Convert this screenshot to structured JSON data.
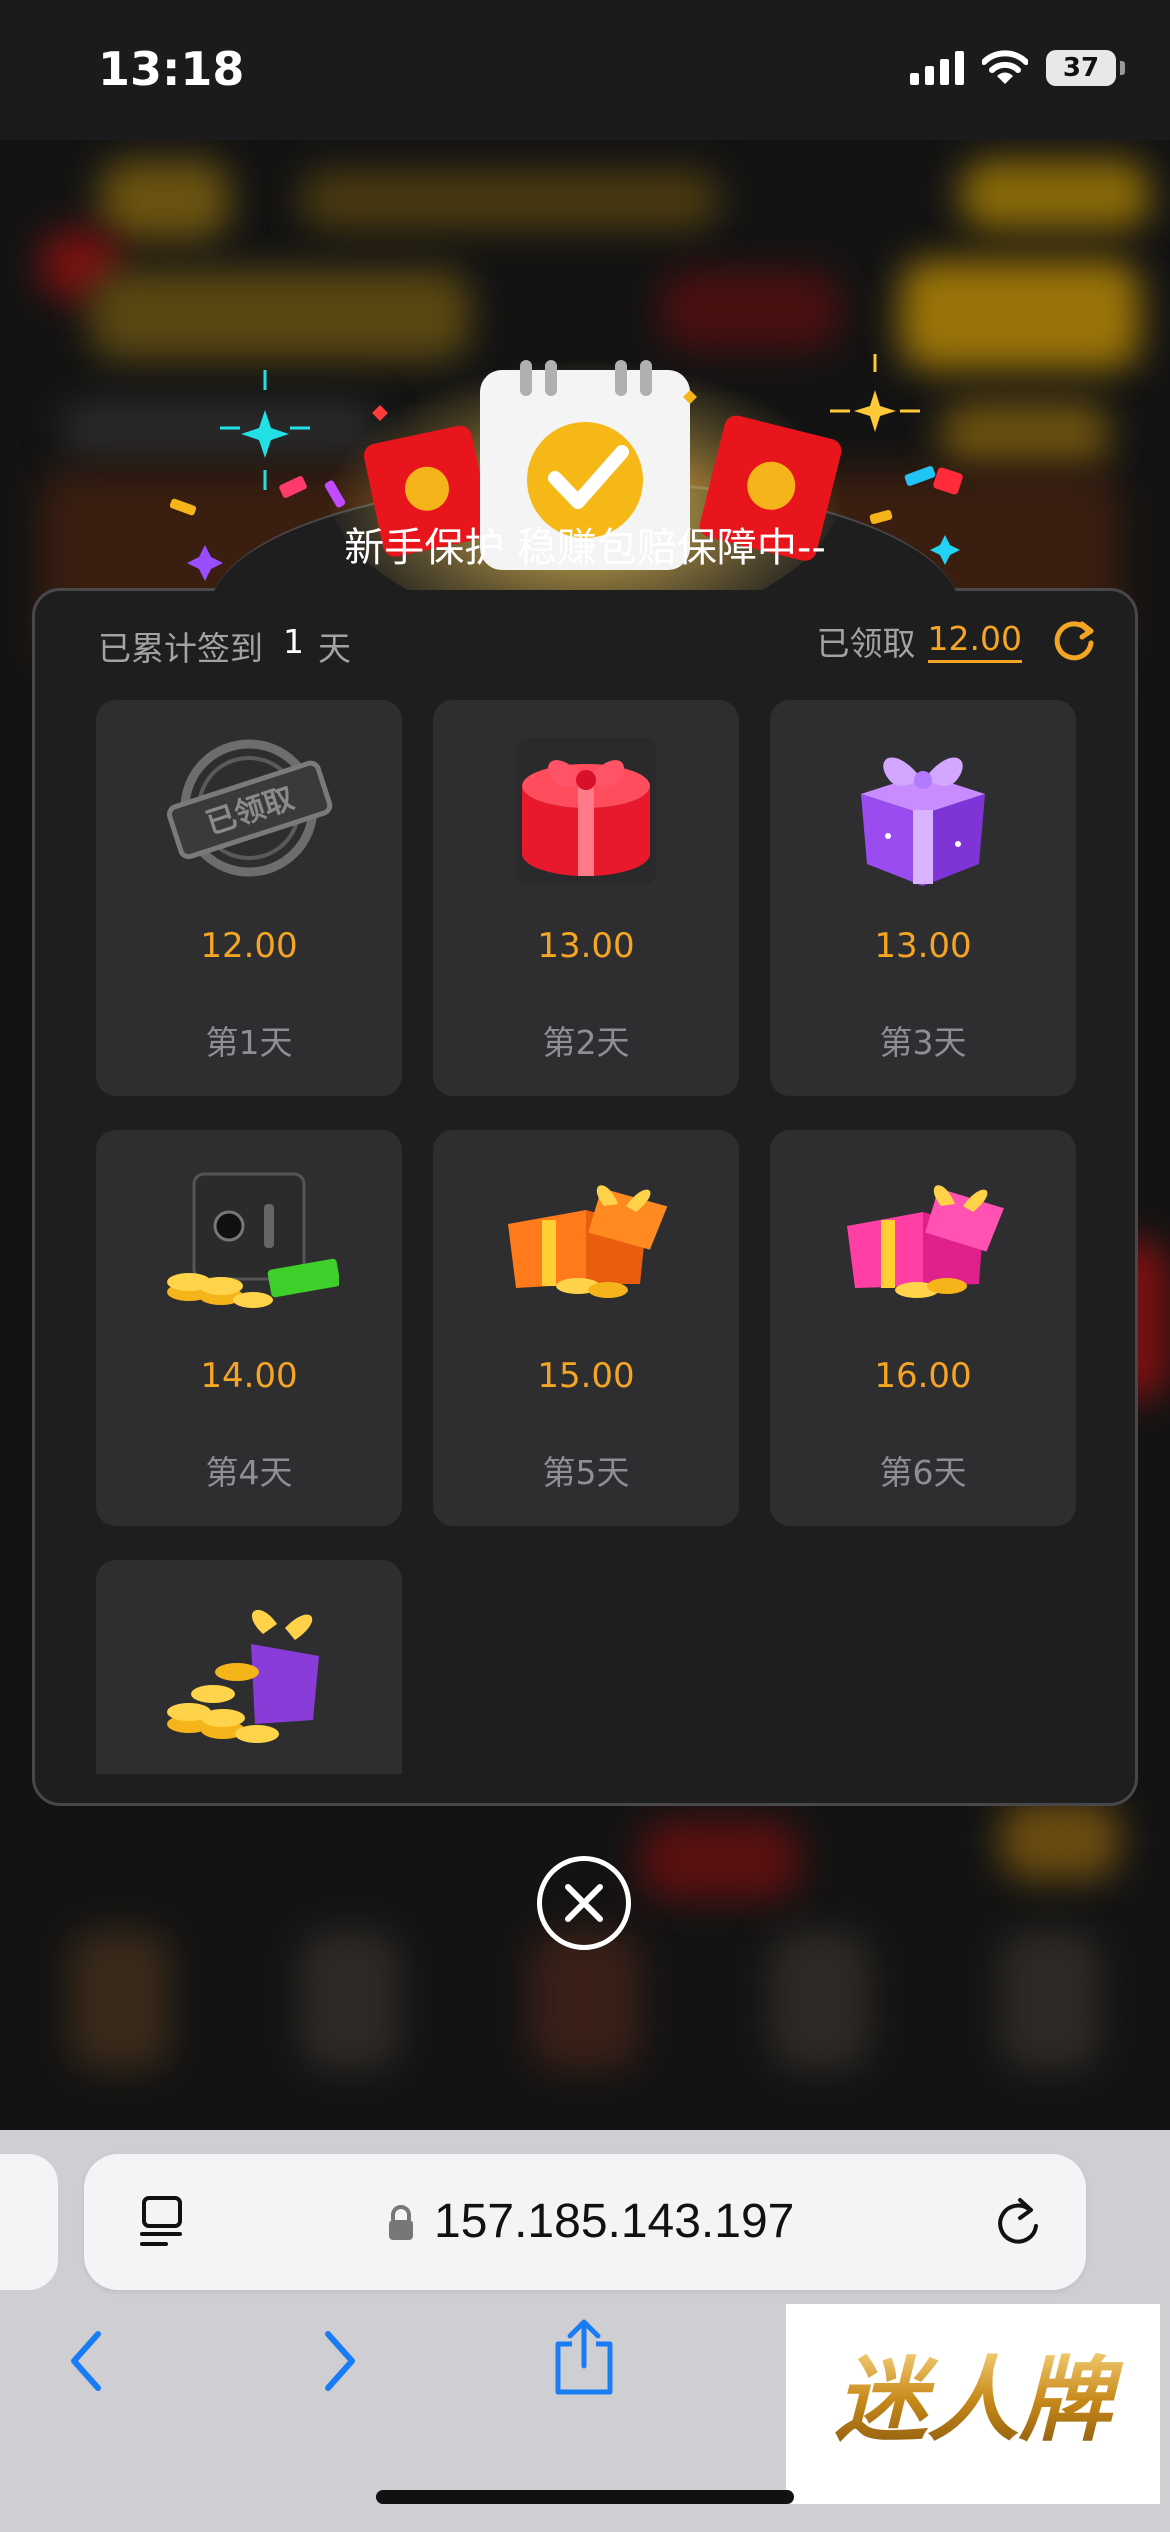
{
  "status_bar": {
    "time": "13:18",
    "battery": "37"
  },
  "modal": {
    "title": "新手保护 稳赚包赔保障中--",
    "summary": {
      "checked_in_label": "已累计签到",
      "days": "1",
      "days_unit": "天",
      "claimed_label": "已领取",
      "claimed_amount": "12.00"
    },
    "stamp_text": "已领取",
    "tiles": [
      {
        "amount": "12.00",
        "day": "第1天",
        "icon": "claimed-stamp-icon"
      },
      {
        "amount": "13.00",
        "day": "第2天",
        "icon": "red-gift-box-icon"
      },
      {
        "amount": "13.00",
        "day": "第3天",
        "icon": "purple-gift-box-icon"
      },
      {
        "amount": "14.00",
        "day": "第4天",
        "icon": "safe-with-coins-icon"
      },
      {
        "amount": "15.00",
        "day": "第5天",
        "icon": "open-orange-gift-coins-icon"
      },
      {
        "amount": "16.00",
        "day": "第6天",
        "icon": "pink-gift-coins-icon"
      },
      {
        "icon": "purple-gift-coin-pile-icon"
      }
    ]
  },
  "browser": {
    "url": "157.185.143.197"
  },
  "watermark": "迷人牌"
}
